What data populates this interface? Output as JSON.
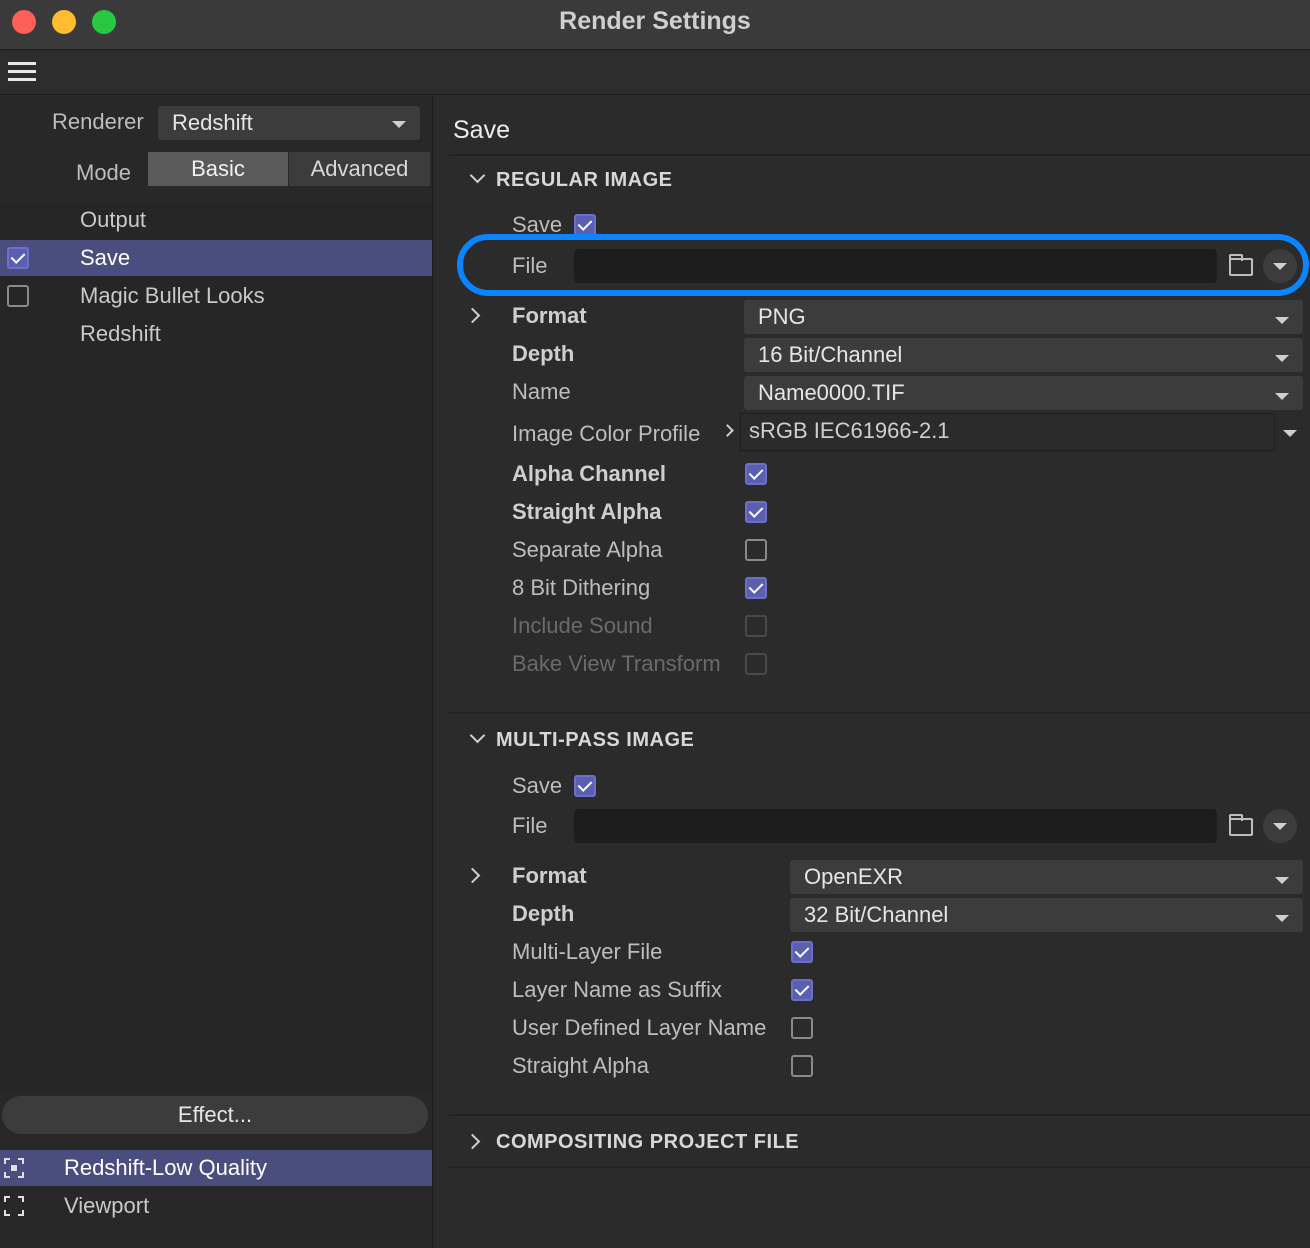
{
  "window": {
    "title": "Render Settings"
  },
  "toolbar": {
    "menu_icon": "hamburger-menu-icon"
  },
  "left": {
    "renderer_label": "Renderer",
    "renderer_value": "Redshift",
    "mode_label": "Mode",
    "mode_basic": "Basic",
    "mode_advanced": "Advanced",
    "nav": [
      {
        "label": "Output",
        "checkbox": null
      },
      {
        "label": "Save",
        "checkbox": true,
        "selected": true
      },
      {
        "label": "Magic Bullet Looks",
        "checkbox": false
      },
      {
        "label": "Redshift",
        "checkbox": null
      }
    ],
    "effect_button": "Effect...",
    "presets": [
      {
        "label": "Redshift-Low Quality",
        "selected": true
      },
      {
        "label": "Viewport",
        "selected": false
      }
    ]
  },
  "right": {
    "title": "Save",
    "regular": {
      "header": "REGULAR IMAGE",
      "save_label": "Save",
      "save_checked": true,
      "file_label": "File",
      "file_value": "",
      "format_label": "Format",
      "format_value": "PNG",
      "depth_label": "Depth",
      "depth_value": "16 Bit/Channel",
      "name_label": "Name",
      "name_value": "Name0000.TIF",
      "profile_label": "Image Color Profile",
      "profile_value": "sRGB IEC61966-2.1",
      "options": [
        {
          "label": "Alpha Channel",
          "checked": true,
          "bold": true,
          "dim": false
        },
        {
          "label": "Straight Alpha",
          "checked": true,
          "bold": true,
          "dim": false
        },
        {
          "label": "Separate Alpha",
          "checked": false,
          "bold": false,
          "dim": false
        },
        {
          "label": "8 Bit Dithering",
          "checked": true,
          "bold": false,
          "dim": false
        },
        {
          "label": "Include Sound",
          "checked": false,
          "bold": false,
          "dim": true
        },
        {
          "label": "Bake View Transform",
          "checked": false,
          "bold": false,
          "dim": true
        }
      ]
    },
    "multipass": {
      "header": "MULTI-PASS IMAGE",
      "save_label": "Save",
      "save_checked": true,
      "file_label": "File",
      "file_value": "",
      "format_label": "Format",
      "format_value": "OpenEXR",
      "depth_label": "Depth",
      "depth_value": "32 Bit/Channel",
      "options": [
        {
          "label": "Multi-Layer File",
          "checked": true
        },
        {
          "label": "Layer Name as Suffix",
          "checked": true
        },
        {
          "label": "User Defined Layer Name",
          "checked": false
        },
        {
          "label": "Straight Alpha",
          "checked": false
        }
      ]
    },
    "compositing": {
      "header": "COMPOSITING PROJECT FILE"
    }
  },
  "colors": {
    "accent": "#0a84ff",
    "selection": "#4a4e7e",
    "checkbox": "#5b5fb0"
  }
}
